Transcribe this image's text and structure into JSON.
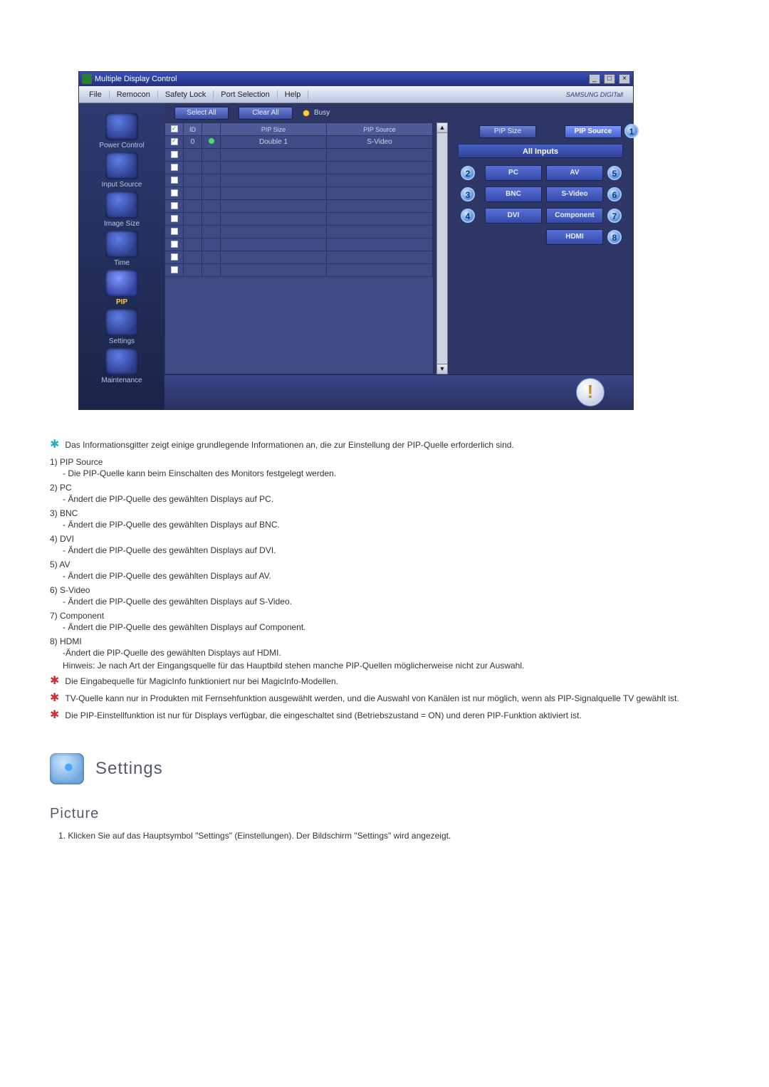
{
  "window": {
    "title": "Multiple Display Control",
    "win_buttons": [
      "_",
      "□",
      "×"
    ],
    "menu": [
      "File",
      "Remocon",
      "Safety Lock",
      "Port Selection",
      "Help"
    ],
    "brand": "SAMSUNG DIGITall",
    "sidebar": [
      {
        "label": "Power Control",
        "active": false
      },
      {
        "label": "Input Source",
        "active": false
      },
      {
        "label": "Image Size",
        "active": false
      },
      {
        "label": "Time",
        "active": false
      },
      {
        "label": "PIP",
        "active": true
      },
      {
        "label": "Settings",
        "active": false
      },
      {
        "label": "Maintenance",
        "active": false
      }
    ],
    "buttons": {
      "select_all": "Select All",
      "clear_all": "Clear All"
    },
    "busy": "Busy",
    "grid": {
      "head": [
        "",
        "ID",
        "",
        "PIP Size",
        "PIP Source"
      ],
      "row0": {
        "id": "0",
        "pip_size": "Double 1",
        "pip_source": "S-Video"
      }
    },
    "right": {
      "pip_size": "PIP Size",
      "pip_source": "PIP Source",
      "all_inputs": "All Inputs",
      "buttons": {
        "pc": "PC",
        "av": "AV",
        "bnc": "BNC",
        "svideo": "S-Video",
        "dvi": "DVI",
        "component": "Component",
        "hdmi": "HDMI"
      }
    }
  },
  "notes": {
    "intro": "Das Informationsgitter zeigt einige grundlegende Informationen an, die zur Einstellung der PIP-Quelle erforderlich sind.",
    "list": [
      {
        "n": "1)",
        "t": "PIP Source",
        "d": "- Die PIP-Quelle kann beim Einschalten des Monitors festgelegt werden."
      },
      {
        "n": "2)",
        "t": "PC",
        "d": "- Ändert die PIP-Quelle des gewählten Displays auf PC."
      },
      {
        "n": "3)",
        "t": "BNC",
        "d": "- Ändert die PIP-Quelle des gewählten Displays auf BNC."
      },
      {
        "n": "4)",
        "t": "DVI",
        "d": "- Ändert die PIP-Quelle des gewählten Displays auf DVI."
      },
      {
        "n": "5)",
        "t": "AV",
        "d": "- Ändert die PIP-Quelle des gewählten Displays auf AV."
      },
      {
        "n": "6)",
        "t": "S-Video",
        "d": "- Ändert die PIP-Quelle des gewählten Displays auf S-Video."
      },
      {
        "n": "7)",
        "t": "Component",
        "d": "- Ändert die PIP-Quelle des gewählten Displays auf Component."
      },
      {
        "n": "8)",
        "t": "HDMI",
        "d": "-Ändert die PIP-Quelle des gewählten Displays auf HDMI."
      }
    ],
    "hint": "Hinweis: Je nach Art der Eingangsquelle für das Hauptbild stehen manche PIP-Quellen möglicherweise nicht zur Auswahl.",
    "red": [
      "Die Eingabequelle für MagicInfo funktioniert nur bei MagicInfo-Modellen.",
      "TV-Quelle kann nur in Produkten mit Fernsehfunktion ausgewählt werden, und die Auswahl von Kanälen ist nur möglich, wenn als PIP-Signalquelle TV gewählt ist.",
      "Die PIP-Einstellfunktion ist nur für Displays verfügbar, die eingeschaltet sind (Betriebszustand = ON) und deren PIP-Funktion aktiviert ist."
    ]
  },
  "settings": {
    "title": "Settings",
    "sub": "Picture",
    "step": "1. Klicken Sie auf das Hauptsymbol \"Settings\" (Einstellungen). Der Bildschirm \"Settings\" wird angezeigt."
  }
}
